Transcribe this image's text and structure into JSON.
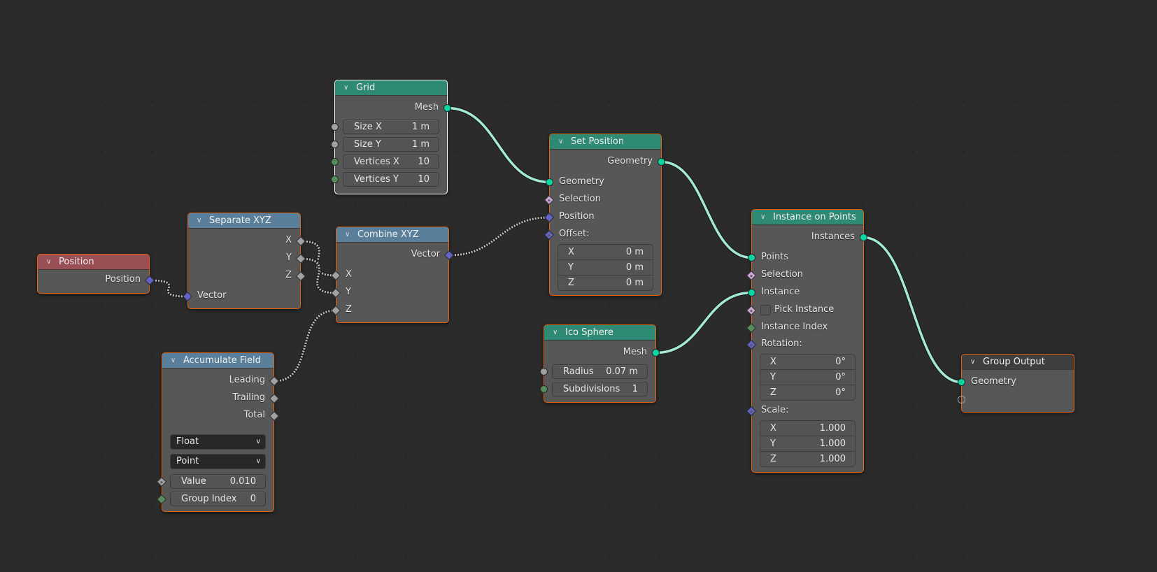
{
  "editor": "Geometry Node Editor",
  "colors": {
    "geometry_socket": "#00d6a3",
    "float_socket": "#a1a1a1",
    "integer_socket": "#598c5c",
    "vector_socket": "#6363c7",
    "boolean_socket": "#cca6d6",
    "geometry_header": "#2e8a74",
    "converter_header": "#597f9a",
    "input_header": "#9a4f55",
    "selection_outline": "#e0620d",
    "active_outline": "#ffffff",
    "link_geometry": "#a4e8d6",
    "link_field": "#bdbdbd"
  },
  "nodes": {
    "grid": {
      "title": "Grid",
      "outputs": [
        "Mesh"
      ],
      "fields": [
        {
          "label": "Size X",
          "value": "1 m"
        },
        {
          "label": "Size Y",
          "value": "1 m"
        },
        {
          "label": "Vertices X",
          "value": "10"
        },
        {
          "label": "Vertices Y",
          "value": "10"
        }
      ]
    },
    "position": {
      "title": "Position",
      "outputs": [
        "Position"
      ]
    },
    "separate_xyz": {
      "title": "Separate XYZ",
      "outputs": [
        "X",
        "Y",
        "Z"
      ],
      "inputs": [
        "Vector"
      ]
    },
    "combine_xyz": {
      "title": "Combine XYZ",
      "outputs": [
        "Vector"
      ],
      "inputs": [
        "X",
        "Y",
        "Z"
      ]
    },
    "accumulate_field": {
      "title": "Accumulate Field",
      "outputs": [
        "Leading",
        "Trailing",
        "Total"
      ],
      "data_type": "Float",
      "domain": "Point",
      "fields": [
        {
          "label": "Value",
          "value": "0.010"
        },
        {
          "label": "Group Index",
          "value": "0"
        }
      ]
    },
    "set_position": {
      "title": "Set Position",
      "outputs": [
        "Geometry"
      ],
      "inputs": [
        "Geometry",
        "Selection",
        "Position",
        "Offset:"
      ],
      "offset": [
        {
          "label": "X",
          "value": "0 m"
        },
        {
          "label": "Y",
          "value": "0 m"
        },
        {
          "label": "Z",
          "value": "0 m"
        }
      ]
    },
    "ico_sphere": {
      "title": "Ico Sphere",
      "outputs": [
        "Mesh"
      ],
      "fields": [
        {
          "label": "Radius",
          "value": "0.07 m"
        },
        {
          "label": "Subdivisions",
          "value": "1"
        }
      ]
    },
    "instance_on_points": {
      "title": "Instance on Points",
      "outputs": [
        "Instances"
      ],
      "inputs": [
        "Points",
        "Selection",
        "Instance",
        "Pick Instance",
        "Instance Index",
        "Rotation:",
        "Scale:"
      ],
      "pick_instance_checked": false,
      "rotation": [
        {
          "label": "X",
          "value": "0°"
        },
        {
          "label": "Y",
          "value": "0°"
        },
        {
          "label": "Z",
          "value": "0°"
        }
      ],
      "scale": [
        {
          "label": "X",
          "value": "1.000"
        },
        {
          "label": "Y",
          "value": "1.000"
        },
        {
          "label": "Z",
          "value": "1.000"
        }
      ]
    },
    "group_output": {
      "title": "Group Output",
      "inputs": [
        "Geometry"
      ]
    }
  },
  "links": [
    {
      "from": "grid.Mesh",
      "to": "set_position.Geometry",
      "kind": "geometry"
    },
    {
      "from": "set_position.Geometry",
      "to": "instance_on_points.Points",
      "kind": "geometry"
    },
    {
      "from": "ico_sphere.Mesh",
      "to": "instance_on_points.Instance",
      "kind": "geometry"
    },
    {
      "from": "instance_on_points.Instances",
      "to": "group_output.Geometry",
      "kind": "geometry"
    },
    {
      "from": "position.Position",
      "to": "separate_xyz.Vector",
      "kind": "field"
    },
    {
      "from": "separate_xyz.X",
      "to": "combine_xyz.X",
      "kind": "field"
    },
    {
      "from": "separate_xyz.Y",
      "to": "combine_xyz.Y",
      "kind": "field"
    },
    {
      "from": "accumulate_field.Leading",
      "to": "combine_xyz.Z",
      "kind": "field"
    },
    {
      "from": "combine_xyz.Vector",
      "to": "set_position.Position",
      "kind": "field"
    }
  ]
}
